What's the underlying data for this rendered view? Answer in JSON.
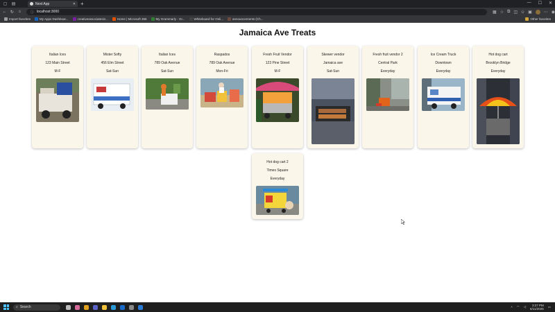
{
  "browser": {
    "tab_title": "Next App",
    "address": "localhost:3000",
    "bookmarks": [
      {
        "label": "Import favorites",
        "color": "#9e9e9e"
      },
      {
        "label": "My Apps Dashboar...",
        "color": "#1565c0"
      },
      {
        "label": "creativeassociatesin...",
        "color": "#7b1fa2"
      },
      {
        "label": "Home | Microsoft 365",
        "color": "#e65100"
      },
      {
        "label": "My Grammarly - Gr...",
        "color": "#2e7d32"
      },
      {
        "label": "Whiteboard for Onli...",
        "color": "#424242"
      },
      {
        "label": "announcements (Ch...",
        "color": "#6d4c41"
      }
    ],
    "other_favorites": "Other favorites"
  },
  "page": {
    "title": "Jamaica Ave Treats",
    "vendors": [
      {
        "name": "Italian Ices",
        "location": "123 Main Street",
        "days": "M-F",
        "photo": "ices-cart-photo"
      },
      {
        "name": "Mister Softy",
        "location": "456 Elm Street",
        "days": "Sat-Sun",
        "photo": "ice-cream-truck-photo"
      },
      {
        "name": "Italian Ices",
        "location": "789 Oak Avenue",
        "days": "Sat-Sun",
        "photo": "ices-vendor-park-photo"
      },
      {
        "name": "Raspados",
        "location": "789 Oak Avenue",
        "days": "Mon-Fri",
        "photo": "raspados-stand-photo"
      },
      {
        "name": "Fresh Fruit Vendor",
        "location": "123 Pine Street",
        "days": "M-F",
        "photo": "fruit-cart-photo"
      },
      {
        "name": "Skewer vendor",
        "location": "Jamaica ave",
        "days": "Sat-Sun",
        "photo": "skewer-grill-photo"
      },
      {
        "name": "Fresh fruit vendor 2",
        "location": "Central Park",
        "days": "Everyday",
        "photo": "fruit-stand-street-photo"
      },
      {
        "name": "Ice Cream Truck",
        "location": "Downtown",
        "days": "Everyday",
        "photo": "ice-cream-truck-street-photo"
      },
      {
        "name": "Hot dog cart",
        "location": "Brooklyn Bridge",
        "days": "Everyday",
        "photo": "hot-dog-umbrella-photo"
      },
      {
        "name": "Hot dog cart 2",
        "location": "Times Square",
        "days": "Everyday",
        "photo": "hot-dog-cart-photo"
      }
    ]
  },
  "taskbar": {
    "search_placeholder": "Search",
    "time": "3:27 PM",
    "date": "6/11/2025"
  }
}
